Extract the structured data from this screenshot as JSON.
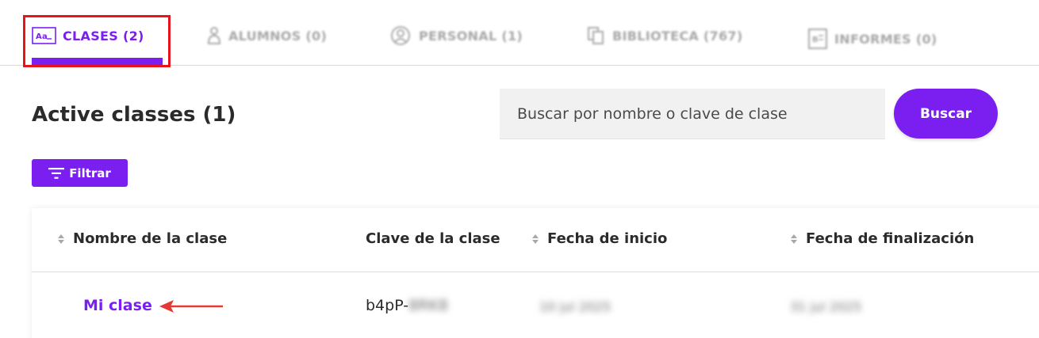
{
  "tabs": [
    {
      "label": "CLASES (2)",
      "icon": "text-box-icon",
      "active": true
    },
    {
      "label": "ALUMNOS (0)",
      "icon": "student-icon",
      "active": false
    },
    {
      "label": "PERSONAL (1)",
      "icon": "person-circle-icon",
      "active": false
    },
    {
      "label": "BIBLIOTECA (767)",
      "icon": "copy-icon",
      "active": false
    },
    {
      "label": "INFORMES (0)",
      "icon": "report-icon",
      "active": false
    }
  ],
  "header": {
    "title": "Active classes (1)"
  },
  "search": {
    "placeholder": "Buscar por nombre o clave de clase",
    "button_label": "Buscar"
  },
  "filter": {
    "label": "Filtrar"
  },
  "table": {
    "columns": [
      "Nombre de la clase",
      "Clave de la clase",
      "Fecha de inicio",
      "Fecha de finalización"
    ],
    "rows": [
      {
        "name": "Mi clase",
        "key_visible": "b4pP-",
        "key_hidden": "8RK8",
        "start_date": "10 jul 2025",
        "end_date": "31 jul 2025"
      }
    ]
  },
  "colors": {
    "accent": "#7a1ff0",
    "highlight": "#e8141b",
    "arrow": "#e53935"
  }
}
